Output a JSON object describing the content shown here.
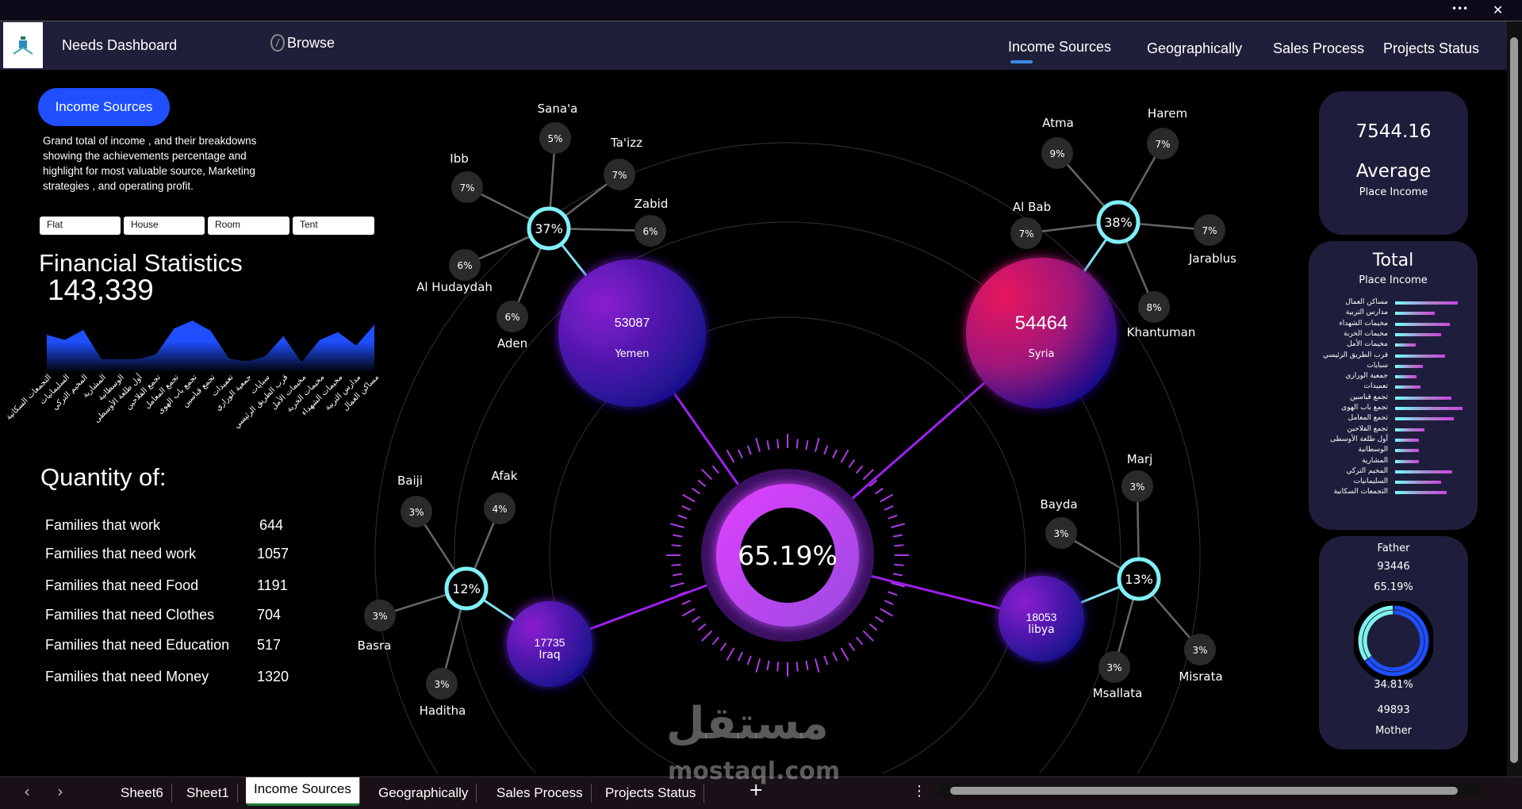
{
  "window": {
    "more_label": "•••",
    "close_label": "✕"
  },
  "header": {
    "title": "Needs Dashboard",
    "browse_label": "Browse",
    "nav": [
      "Income Sources",
      "Geographically",
      "Sales Process",
      "Projects Status"
    ],
    "active_nav": 0
  },
  "left": {
    "button_label": "Income Sources",
    "description": "Grand total of income , and their breakdowns showing the achievements percentage and highlight for most valuable source, Marketing strategies , and operating profit.",
    "filters": [
      "Flat",
      "House",
      "Room",
      "Tent"
    ],
    "stats_title": "Financial Statistics",
    "stats_total": "143,339",
    "quantity_title": "Quantity of:",
    "quantities": [
      {
        "label": "Families that work",
        "value": "644"
      },
      {
        "label": "Families that need  work",
        "value": "1057"
      },
      {
        "label": "Families that need  Food",
        "value": "1191"
      },
      {
        "label": "Families that need  Clothes",
        "value": "704"
      },
      {
        "label": "Families that need  Education",
        "value": "517"
      },
      {
        "label": "Families that need  Money",
        "value": "1320"
      }
    ]
  },
  "area_chart": {
    "type": "area",
    "categories": [
      "التجمعات السكانية",
      "السليمانيات",
      "المخيم التركي",
      "المشارية",
      "الوسطانية",
      "أول طلعة الأوسطى",
      "تجمع الفلاحين",
      "تجمع المعامل",
      "تجمع باب الهوى",
      "تجمع قباسين",
      "تعميدات",
      "جمعية الوراري",
      "سبايات",
      "قرب الطريق الرئيسي",
      "مخيمات الأمل",
      "مخيمات الخربة",
      "مخيمات الشهداء",
      "مدارس التربية",
      "مساكن العمال"
    ],
    "values": [
      9400,
      8350,
      10400,
      4400,
      4400,
      4400,
      5400,
      10700,
      12300,
      10250,
      4550,
      3950,
      5000,
      9100,
      3800,
      8350,
      9950,
      7200,
      11450
    ],
    "color": "#1f4fff"
  },
  "center": {
    "percent": "65.19%"
  },
  "regions": [
    {
      "name": "Yemen",
      "value": "53087",
      "hub": "37%",
      "sats": [
        {
          "name": "Sana'a",
          "pct": "5%"
        },
        {
          "name": "Ta'izz",
          "pct": "7%"
        },
        {
          "name": "Zabid",
          "pct": "6%"
        },
        {
          "name": "Ibb",
          "pct": "7%"
        },
        {
          "name": "Al Hudaydah",
          "pct": "6%"
        },
        {
          "name": "Aden",
          "pct": "6%"
        }
      ]
    },
    {
      "name": "Syria",
      "value": "54464",
      "hub": "38%",
      "sats": [
        {
          "name": "Atma",
          "pct": "9%"
        },
        {
          "name": "Harem",
          "pct": "7%"
        },
        {
          "name": "Al Bab",
          "pct": "7%"
        },
        {
          "name": "Jarablus",
          "pct": "7%"
        },
        {
          "name": "Khantuman",
          "pct": "8%"
        }
      ]
    },
    {
      "name": "Iraq",
      "value": "17735",
      "hub": "12%",
      "sats": [
        {
          "name": "Baiji",
          "pct": "3%"
        },
        {
          "name": "Afak",
          "pct": "4%"
        },
        {
          "name": "Basra",
          "pct": "3%"
        },
        {
          "name": "Haditha",
          "pct": "3%"
        }
      ]
    },
    {
      "name": "libya",
      "value": "18053",
      "hub": "13%",
      "sats": [
        {
          "name": "Marj",
          "pct": "3%"
        },
        {
          "name": "Bayda",
          "pct": "3%"
        },
        {
          "name": "Misrata",
          "pct": "3%"
        },
        {
          "name": "Msallata",
          "pct": "3%"
        }
      ]
    }
  ],
  "right": {
    "average_value": "7544.16",
    "average_title": "Average",
    "average_sub": "Place Income",
    "total_title": "Total",
    "total_sub": "Place Income",
    "father_label": "Father",
    "father_value": "93446",
    "father_pct": "65.19%",
    "father_fraction": 0.6519,
    "mother_pct": "34.81%",
    "mother_value": "49893",
    "mother_label": "Mother"
  },
  "sheets": {
    "tabs": [
      "Sheet6",
      "Sheet1",
      "Income Sources",
      "Geographically",
      "Sales Process",
      "Projects Status"
    ],
    "active": 2,
    "add_label": "+",
    "more_label": "⋮",
    "prev": "‹",
    "next": "›"
  },
  "watermark": {
    "arabic": "مستقل",
    "latin": "mostaql.com"
  }
}
